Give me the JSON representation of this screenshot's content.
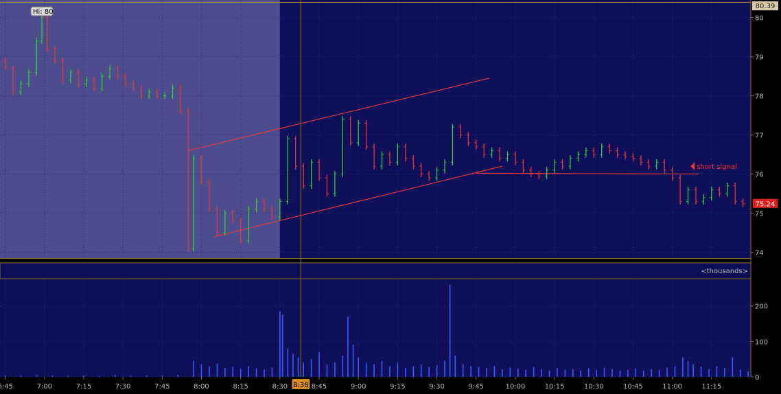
{
  "chart_data": [
    {
      "type": "candlestick",
      "panel": "price",
      "hi_label": "Hi: 80",
      "current_price_label": "80.39",
      "last_price_label": "75.24",
      "y_ticks": [
        "80",
        "79",
        "78",
        "77",
        "76",
        "75",
        "74"
      ],
      "ylim": [
        73.85,
        80.45
      ],
      "premarket_shaded_until": "8:30",
      "annotation": {
        "text": "short signal",
        "color": "#ff3030"
      },
      "channel": {
        "upper": [
          [
            "7:55",
            76.6
          ],
          [
            "9:50",
            78.45
          ]
        ],
        "lower": [
          [
            "8:05",
            74.4
          ],
          [
            "9:55",
            76.2
          ]
        ],
        "support": [
          [
            "9:45",
            76.02
          ],
          [
            "11:10",
            76.0
          ]
        ]
      },
      "series": [
        {
          "values": [
            [
              "6:45",
              78.9,
              78.75
            ],
            [
              "6:48",
              78.7,
              78.1
            ],
            [
              "6:51",
              78.1,
              78.3
            ],
            [
              "6:54",
              78.3,
              78.6
            ],
            [
              "6:57",
              78.6,
              79.4
            ],
            [
              "6:59",
              79.4,
              80.0
            ],
            [
              "7:01",
              80.0,
              79.2
            ],
            [
              "7:04",
              79.2,
              78.9
            ],
            [
              "7:07",
              78.9,
              78.4
            ],
            [
              "7:10",
              78.4,
              78.6
            ],
            [
              "7:13",
              78.6,
              78.3
            ],
            [
              "7:16",
              78.3,
              78.4
            ],
            [
              "7:19",
              78.4,
              78.2
            ],
            [
              "7:22",
              78.2,
              78.5
            ],
            [
              "7:25",
              78.5,
              78.7
            ],
            [
              "7:28",
              78.7,
              78.5
            ],
            [
              "7:31",
              78.5,
              78.3
            ],
            [
              "7:34",
              78.3,
              78.2
            ],
            [
              "7:37",
              78.2,
              78.0
            ],
            [
              "7:40",
              78.0,
              78.1
            ],
            [
              "7:43",
              78.1,
              78.0
            ],
            [
              "7:46",
              78.0,
              78.0
            ],
            [
              "7:49",
              78.0,
              78.2
            ],
            [
              "7:52",
              78.2,
              77.6
            ],
            [
              "7:55",
              77.6,
              74.1
            ],
            [
              "7:57",
              74.1,
              76.4
            ],
            [
              "8:00",
              76.4,
              75.8
            ],
            [
              "8:03",
              75.8,
              75.1
            ],
            [
              "8:06",
              75.1,
              74.5
            ],
            [
              "8:09",
              74.5,
              75.0
            ],
            [
              "8:12",
              75.0,
              74.8
            ],
            [
              "8:15",
              74.8,
              74.3
            ],
            [
              "8:18",
              74.3,
              75.1
            ],
            [
              "8:21",
              75.1,
              75.3
            ],
            [
              "8:24",
              75.3,
              75.1
            ],
            [
              "8:27",
              75.1,
              74.9
            ],
            [
              "8:30",
              74.9,
              75.3
            ],
            [
              "8:33",
              75.3,
              76.9
            ],
            [
              "8:36",
              76.9,
              76.2
            ],
            [
              "8:39",
              76.2,
              75.7
            ],
            [
              "8:42",
              75.7,
              76.3
            ],
            [
              "8:45",
              76.3,
              75.9
            ],
            [
              "8:48",
              75.9,
              75.5
            ],
            [
              "8:51",
              75.5,
              76.0
            ],
            [
              "8:54",
              76.0,
              77.4
            ],
            [
              "8:57",
              77.4,
              76.8
            ],
            [
              "9:00",
              76.8,
              77.3
            ],
            [
              "9:03",
              77.3,
              76.7
            ],
            [
              "9:06",
              76.7,
              76.2
            ],
            [
              "9:09",
              76.2,
              76.5
            ],
            [
              "9:12",
              76.5,
              76.3
            ],
            [
              "9:15",
              76.3,
              76.7
            ],
            [
              "9:18",
              76.7,
              76.4
            ],
            [
              "9:21",
              76.4,
              76.2
            ],
            [
              "9:24",
              76.2,
              76.0
            ],
            [
              "9:27",
              76.0,
              75.9
            ],
            [
              "9:30",
              75.9,
              76.1
            ],
            [
              "9:33",
              76.1,
              76.3
            ],
            [
              "9:36",
              76.3,
              77.2
            ],
            [
              "9:39",
              77.2,
              77.0
            ],
            [
              "9:42",
              77.0,
              76.8
            ],
            [
              "9:45",
              76.8,
              76.7
            ],
            [
              "9:48",
              76.7,
              76.5
            ],
            [
              "9:51",
              76.5,
              76.6
            ],
            [
              "9:54",
              76.6,
              76.4
            ],
            [
              "9:57",
              76.4,
              76.5
            ],
            [
              "10:00",
              76.5,
              76.3
            ],
            [
              "10:03",
              76.3,
              76.1
            ],
            [
              "10:06",
              76.1,
              76.0
            ],
            [
              "10:09",
              76.0,
              75.95
            ],
            [
              "10:12",
              75.95,
              76.1
            ],
            [
              "10:15",
              76.1,
              76.3
            ],
            [
              "10:18",
              76.3,
              76.2
            ],
            [
              "10:21",
              76.2,
              76.4
            ],
            [
              "10:24",
              76.4,
              76.5
            ],
            [
              "10:27",
              76.5,
              76.6
            ],
            [
              "10:30",
              76.6,
              76.5
            ],
            [
              "10:33",
              76.5,
              76.7
            ],
            [
              "10:36",
              76.7,
              76.6
            ],
            [
              "10:39",
              76.6,
              76.5
            ],
            [
              "10:42",
              76.5,
              76.45
            ],
            [
              "10:45",
              76.45,
              76.4
            ],
            [
              "10:48",
              76.4,
              76.3
            ],
            [
              "10:51",
              76.3,
              76.2
            ],
            [
              "10:54",
              76.2,
              76.3
            ],
            [
              "10:57",
              76.3,
              76.1
            ],
            [
              "11:00",
              76.1,
              75.9
            ],
            [
              "11:03",
              75.9,
              75.3
            ],
            [
              "11:06",
              75.3,
              75.6
            ],
            [
              "11:09",
              75.6,
              75.3
            ],
            [
              "11:12",
              75.3,
              75.4
            ],
            [
              "11:15",
              75.4,
              75.6
            ],
            [
              "11:18",
              75.6,
              75.5
            ],
            [
              "11:21",
              75.5,
              75.7
            ],
            [
              "11:24",
              75.7,
              75.3
            ],
            [
              "11:27",
              75.3,
              75.24
            ]
          ]
        }
      ]
    },
    {
      "type": "bar",
      "panel": "volume",
      "unit_label": "<thousands>",
      "y_ticks": [
        "200",
        "100",
        "0"
      ],
      "ylim": [
        0,
        275
      ],
      "series": [
        {
          "values": [
            [
              "6:45",
              4
            ],
            [
              "6:51",
              3
            ],
            [
              "6:57",
              5
            ],
            [
              "7:03",
              4
            ],
            [
              "7:09",
              3
            ],
            [
              "7:15",
              4
            ],
            [
              "7:21",
              3
            ],
            [
              "7:27",
              5
            ],
            [
              "7:33",
              3
            ],
            [
              "7:39",
              4
            ],
            [
              "7:45",
              3
            ],
            [
              "7:51",
              5
            ],
            [
              "7:57",
              45
            ],
            [
              "8:00",
              35
            ],
            [
              "8:03",
              30
            ],
            [
              "8:06",
              38
            ],
            [
              "8:09",
              25
            ],
            [
              "8:12",
              28
            ],
            [
              "8:15",
              22
            ],
            [
              "8:18",
              30
            ],
            [
              "8:21",
              24
            ],
            [
              "8:24",
              20
            ],
            [
              "8:27",
              26
            ],
            [
              "8:30",
              185
            ],
            [
              "8:31",
              175
            ],
            [
              "8:33",
              80
            ],
            [
              "8:35",
              65
            ],
            [
              "8:37",
              55
            ],
            [
              "8:39",
              40
            ],
            [
              "8:42",
              50
            ],
            [
              "8:45",
              70
            ],
            [
              "8:48",
              35
            ],
            [
              "8:51",
              40
            ],
            [
              "8:54",
              60
            ],
            [
              "8:56",
              170
            ],
            [
              "8:58",
              90
            ],
            [
              "9:00",
              55
            ],
            [
              "9:03",
              40
            ],
            [
              "9:06",
              35
            ],
            [
              "9:09",
              45
            ],
            [
              "9:12",
              30
            ],
            [
              "9:15",
              40
            ],
            [
              "9:18",
              25
            ],
            [
              "9:21",
              30
            ],
            [
              "9:24",
              35
            ],
            [
              "9:27",
              28
            ],
            [
              "9:30",
              32
            ],
            [
              "9:33",
              45
            ],
            [
              "9:35",
              260
            ],
            [
              "9:37",
              60
            ],
            [
              "9:40",
              35
            ],
            [
              "9:43",
              30
            ],
            [
              "9:46",
              28
            ],
            [
              "9:49",
              25
            ],
            [
              "9:52",
              30
            ],
            [
              "9:55",
              22
            ],
            [
              "9:58",
              26
            ],
            [
              "10:01",
              24
            ],
            [
              "10:04",
              20
            ],
            [
              "10:07",
              28
            ],
            [
              "10:10",
              22
            ],
            [
              "10:13",
              18
            ],
            [
              "10:16",
              25
            ],
            [
              "10:19",
              20
            ],
            [
              "10:22",
              22
            ],
            [
              "10:25",
              18
            ],
            [
              "10:28",
              24
            ],
            [
              "10:31",
              20
            ],
            [
              "10:34",
              26
            ],
            [
              "10:37",
              22
            ],
            [
              "10:40",
              18
            ],
            [
              "10:43",
              20
            ],
            [
              "10:46",
              24
            ],
            [
              "10:49",
              18
            ],
            [
              "10:52",
              22
            ],
            [
              "10:55",
              20
            ],
            [
              "10:58",
              26
            ],
            [
              "11:01",
              30
            ],
            [
              "11:04",
              55
            ],
            [
              "11:06",
              45
            ],
            [
              "11:08",
              35
            ],
            [
              "11:11",
              28
            ],
            [
              "11:14",
              22
            ],
            [
              "11:17",
              30
            ],
            [
              "11:20",
              25
            ],
            [
              "11:23",
              55
            ],
            [
              "11:26",
              20
            ],
            [
              "11:29",
              15
            ]
          ]
        }
      ]
    },
    {
      "type": "axis",
      "panel": "time",
      "x_ticks": [
        "6:45",
        "7:00",
        "7:15",
        "7:30",
        "7:45",
        "8:00",
        "8:15",
        "8:30",
        "8:45",
        "9:00",
        "9:15",
        "9:30",
        "9:45",
        "10:00",
        "10:15",
        "10:30",
        "10:45",
        "11:00",
        "11:15"
      ],
      "cursor_time": "8:38",
      "xlim": [
        "6:43",
        "11:30"
      ]
    }
  ]
}
